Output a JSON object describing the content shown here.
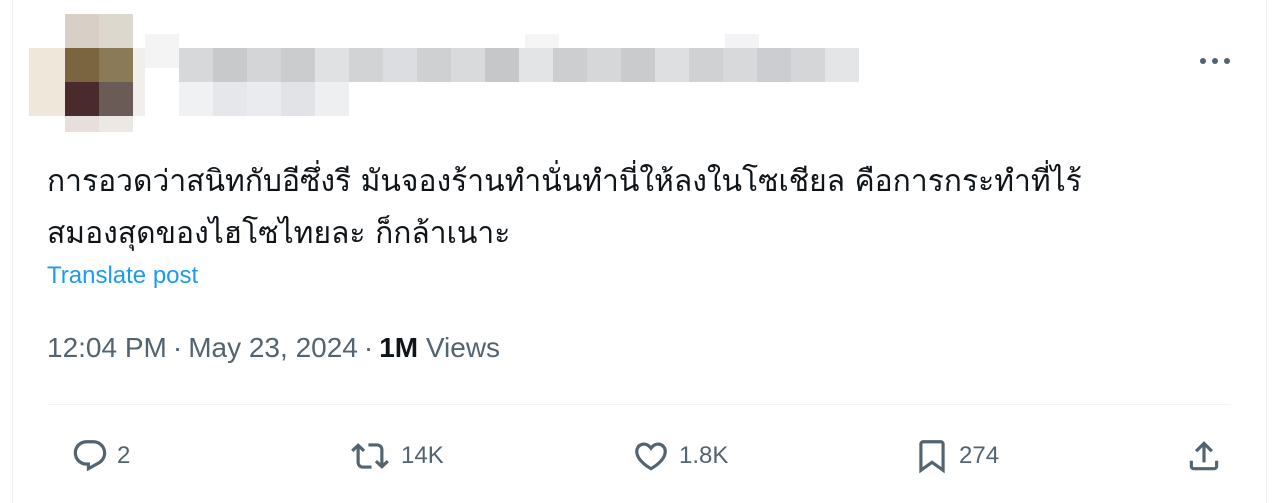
{
  "tweet": {
    "text_lines": [
      "การอวดว่าสนิทกับอีซึ่งรี มันจองร้านทำนั่นทำนี่ให้ลงในโซเชียล คือการกระทำที่ไร้",
      "สมองสุดของไฮโซไทยละ ก็กล้าเนาะ"
    ],
    "translate_label": "Translate post",
    "time": "12:04 PM",
    "date": "May 23, 2024",
    "separator": "·",
    "views_count": "1M",
    "views_label": "Views"
  },
  "actions": {
    "reply_count": "2",
    "repost_count": "14K",
    "like_count": "1.8K",
    "bookmark_count": "274"
  },
  "icons": {
    "more": "more-horizontal-icon",
    "reply": "reply-bubble-icon",
    "repost": "repost-arrows-icon",
    "like": "heart-icon",
    "bookmark": "bookmark-icon",
    "share": "share-upload-icon"
  },
  "colors": {
    "text": "#0f1419",
    "secondary": "#536471",
    "link": "#1d9bf0",
    "divider": "#eff3f4"
  }
}
